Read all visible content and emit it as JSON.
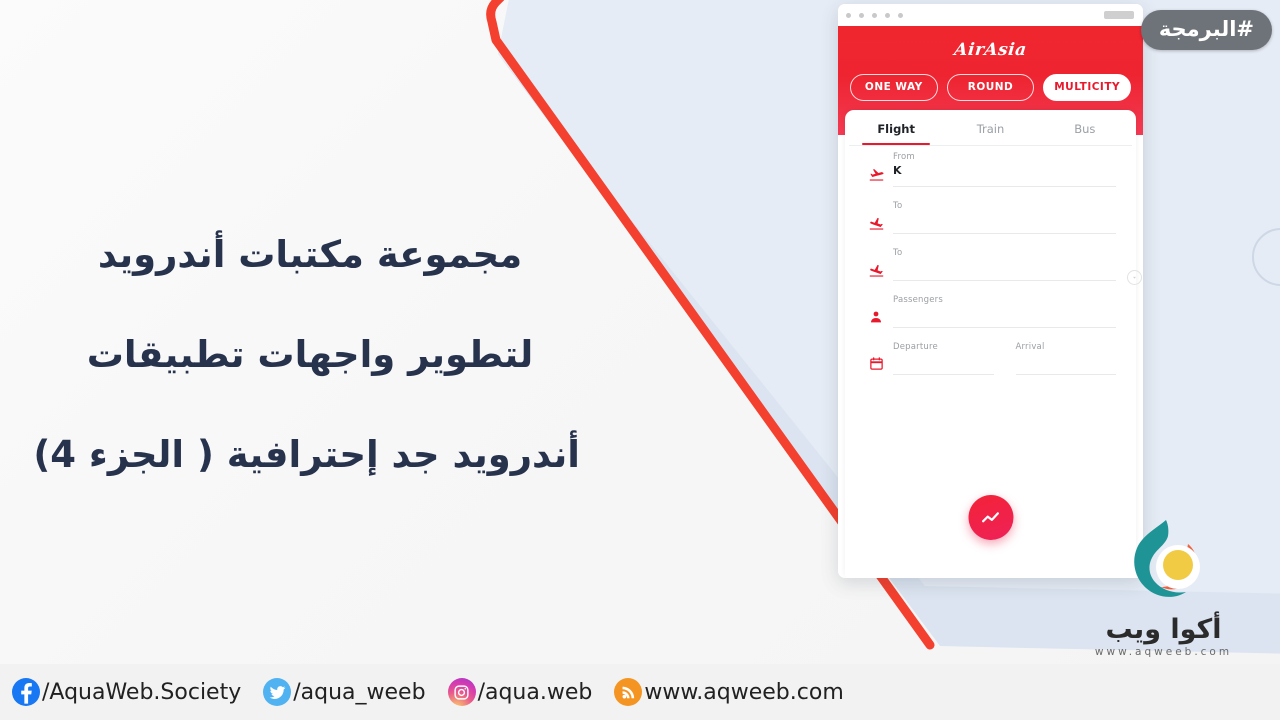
{
  "badge": {
    "label": "#البرمجة"
  },
  "headline": {
    "lines": [
      "مجموعة مكتبات أندرويد",
      "لتطوير واجهات تطبيقات",
      "أندرويد جد إحترافية ( الجزء 4)"
    ]
  },
  "mockup": {
    "chrome": {
      "dot_count": 5,
      "address_bar": ""
    },
    "app": {
      "brand": "AirAsia",
      "trip_types": [
        {
          "label": "ONE WAY",
          "active": false
        },
        {
          "label": "ROUND",
          "active": false
        },
        {
          "label": "MULTICITY",
          "active": true
        }
      ],
      "tabs": [
        {
          "label": "Flight",
          "active": true
        },
        {
          "label": "Train",
          "active": false
        },
        {
          "label": "Bus",
          "active": false
        }
      ],
      "fields": [
        {
          "icon": "flight-takeoff-icon",
          "label": "From",
          "value": "K"
        },
        {
          "icon": "flight-land-icon",
          "label": "To",
          "value": ""
        },
        {
          "icon": "flight-land-icon",
          "label": "To",
          "value": ""
        },
        {
          "icon": "person-icon",
          "label": "Passengers",
          "value": ""
        }
      ],
      "date_row": {
        "icon": "calendar-icon",
        "departure_label": "Departure",
        "departure_value": "",
        "arrival_label": "Arrival",
        "arrival_value": ""
      },
      "fab": {
        "icon": "trending-line-icon"
      }
    }
  },
  "footer": {
    "social": [
      {
        "icon": "facebook-icon",
        "handle": "/AquaWeb.Society",
        "color": "#1877f2"
      },
      {
        "icon": "twitter-icon",
        "handle": "/aqua_weeb",
        "color": "#51b2f1"
      },
      {
        "icon": "instagram-icon",
        "handle": "/aqua.web",
        "color": "#d63bb0"
      },
      {
        "icon": "rss-icon",
        "handle": "www.aqweeb.com",
        "color": "#f49523"
      }
    ]
  },
  "logo": {
    "name": "أكوا ويب",
    "url": "www.aqweeb.com",
    "teal": "#1f9496",
    "orange": "#f0613c",
    "yellow": "#f2cb45"
  },
  "colors": {
    "accent_red": "#ee2430",
    "panel_blue": "#dbe4f0",
    "diagonal_red": "#f4402e",
    "headline_navy": "#27334d",
    "badge_grey": "#6e7279"
  }
}
